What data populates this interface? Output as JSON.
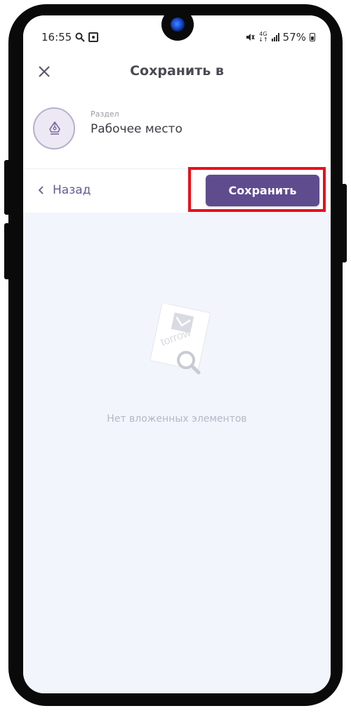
{
  "status_bar": {
    "time": "16:55",
    "network": "4G",
    "battery": "57%"
  },
  "header": {
    "title": "Сохранить в",
    "close_icon": "close-icon"
  },
  "section": {
    "label": "Раздел",
    "value": "Рабочее место",
    "icon": "workspace-pen-icon"
  },
  "actions": {
    "back_label": "Назад",
    "save_label": "Сохранить"
  },
  "empty_state": {
    "watermark": "torrow",
    "message": "Нет вложенных элементов"
  },
  "colors": {
    "accent": "#5f4c8f",
    "back_link": "#6a5a92",
    "highlight": "#e8101a",
    "background": "#f2f5fb"
  }
}
